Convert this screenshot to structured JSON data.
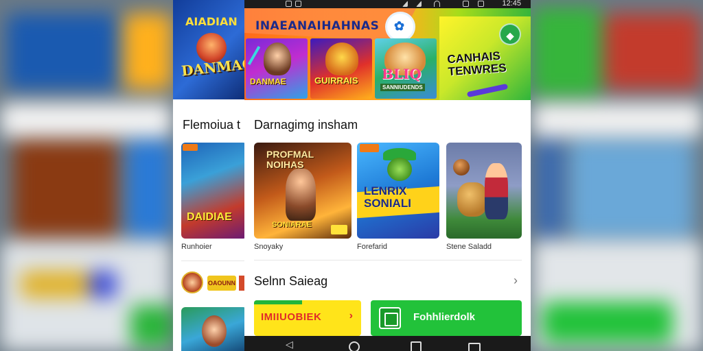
{
  "statusbar": {
    "clock": "12:45"
  },
  "hero": {
    "title": "INAEANAIHAHNAS",
    "tiles": [
      {
        "logo": "DANMAE"
      },
      {
        "logo": "GUIRRAIS"
      },
      {
        "logo": "BLIQ",
        "sub": "SANNIUDENDS"
      },
      {
        "logo": "CANHAIS TENWRES",
        "button_icon": "gamepad-icon"
      }
    ]
  },
  "left_screen": {
    "banner_title": "AIADIAN",
    "banner_logo": "DANMAG",
    "section_title": "Flemoiua t",
    "card_logo": "DAIDIAE",
    "card_label": "Runhoier",
    "mini_tag": "OAOUNN"
  },
  "main": {
    "section_title": "Darnagimg insham",
    "cards": [
      {
        "logo": "PROFMAL NOIHAS",
        "sub": "SONIARAE",
        "label": "Snoyaky"
      },
      {
        "logo": "LENRIX SONIALI",
        "label": "Forefarid"
      },
      {
        "logo": "",
        "label": "Stene Saladd"
      }
    ],
    "section2_title": "Selnn Saieag",
    "yellow_button": {
      "label": "IMIIUOBIEK",
      "arrow": "›"
    },
    "green_button": {
      "label": "Fohhlierdolk"
    }
  },
  "colors": {
    "hero_start": "#ff6a1a",
    "hero_end": "#36b53b",
    "yellow_button": "#ffe41a",
    "green_button": "#22c23a"
  }
}
